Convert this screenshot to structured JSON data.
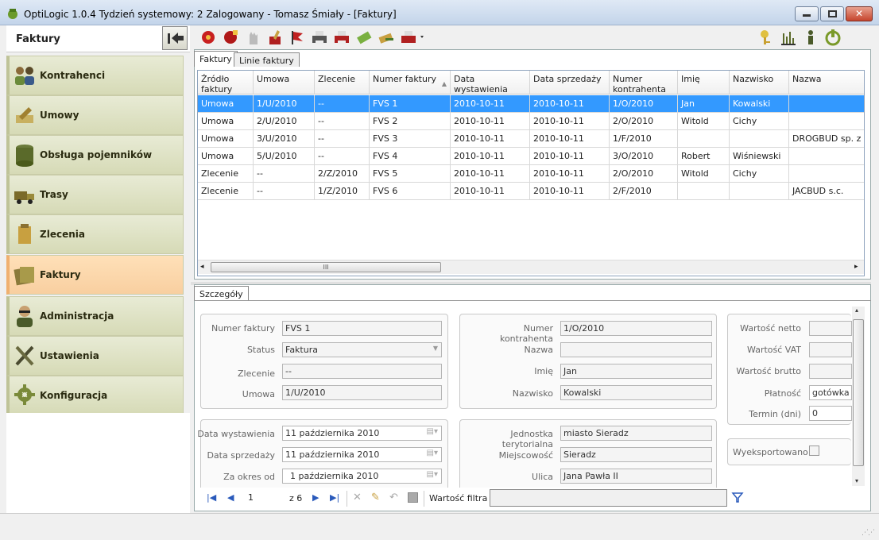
{
  "window": {
    "title": "OptiLogic 1.0.4  Tydzień systemowy: 2  Zalogowany - Tomasz Śmiały - [Faktury]"
  },
  "sidebar": {
    "header": "Faktury",
    "items": [
      {
        "label": "Kontrahenci",
        "icon": "contractors-icon"
      },
      {
        "label": "Umowy",
        "icon": "contracts-icon"
      },
      {
        "label": "Obsługa pojemników",
        "icon": "containers-icon"
      },
      {
        "label": "Trasy",
        "icon": "truck-icon"
      },
      {
        "label": "Zlecenia",
        "icon": "orders-icon"
      },
      {
        "label": "Faktury",
        "icon": "invoices-icon",
        "active": true
      },
      {
        "label": "Administracja",
        "icon": "admin-icon"
      },
      {
        "label": "Ustawienia",
        "icon": "tools-icon"
      },
      {
        "label": "Konfiguracja",
        "icon": "gear-icon"
      }
    ]
  },
  "tabs": {
    "top": [
      "Faktury",
      "Linie faktury"
    ],
    "bottom": "Szczegóły"
  },
  "grid": {
    "headers": [
      "Źródło faktury",
      "Umowa",
      "Zlecenie",
      "Numer faktury",
      "Data wystawienia",
      "Data sprzedaży",
      "Numer kontrahenta",
      "Imię",
      "Nazwisko",
      "Nazwa"
    ],
    "rows": [
      [
        "Umowa",
        "1/U/2010",
        "--",
        "FVS 1",
        "2010-10-11",
        "2010-10-11",
        "1/O/2010",
        "Jan",
        "Kowalski",
        ""
      ],
      [
        "Umowa",
        "2/U/2010",
        "--",
        "FVS 2",
        "2010-10-11",
        "2010-10-11",
        "2/O/2010",
        "Witold",
        "Cichy",
        ""
      ],
      [
        "Umowa",
        "3/U/2010",
        "--",
        "FVS 3",
        "2010-10-11",
        "2010-10-11",
        "1/F/2010",
        "",
        "",
        "DROGBUD sp. z o.o."
      ],
      [
        "Umowa",
        "5/U/2010",
        "--",
        "FVS 4",
        "2010-10-11",
        "2010-10-11",
        "3/O/2010",
        "Robert",
        "Wiśniewski",
        ""
      ],
      [
        "Zlecenie",
        "--",
        "2/Z/2010",
        "FVS 5",
        "2010-10-11",
        "2010-10-11",
        "2/O/2010",
        "Witold",
        "Cichy",
        ""
      ],
      [
        "Zlecenie",
        "--",
        "1/Z/2010",
        "FVS 6",
        "2010-10-11",
        "2010-10-11",
        "2/F/2010",
        "",
        "",
        "JACBUD s.c."
      ]
    ],
    "scroll_glyph": "III"
  },
  "details": {
    "numer_faktury_label": "Numer faktury",
    "numer_faktury": "FVS 1",
    "status_label": "Status",
    "status": "Faktura",
    "zlecenie_label": "Zlecenie",
    "zlecenie": "--",
    "umowa_label": "Umowa",
    "umowa": "1/U/2010",
    "numer_kontrahenta_label": "Numer kontrahenta",
    "numer_kontrahenta": "1/O/2010",
    "nazwa_label": "Nazwa",
    "nazwa": "",
    "imie_label": "Imię",
    "imie": "Jan",
    "nazwisko_label": "Nazwisko",
    "nazwisko": "Kowalski",
    "netto_label": "Wartość netto",
    "vat_label": "Wartość VAT",
    "brutto_label": "Wartość brutto",
    "platnosc_label": "Płatność",
    "platnosc": "gotówka",
    "termin_label": "Termin (dni)",
    "termin": "0",
    "data_wyst_label": "Data wystawienia",
    "data_wyst": "11 października 2010",
    "data_sprz_label": "Data sprzedaży",
    "data_sprz": "11 października 2010",
    "okres_label": "Za okres od",
    "okres": "1 października 2010",
    "jednostka_label": "Jednostka terytorialna",
    "jednostka": "miasto Sieradz",
    "miejscowosc_label": "Miejscowość",
    "miejscowosc": "Sieradz",
    "ulica_label": "Ulica",
    "ulica": "Jana Pawła II",
    "eksport_label": "Wyeksportowano"
  },
  "navigator": {
    "page": "1",
    "of": "z 6",
    "filter_label": "Wartość filtra",
    "filter_value": ""
  }
}
